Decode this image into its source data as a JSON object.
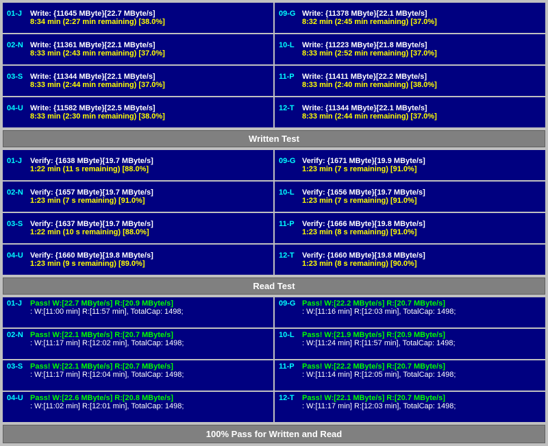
{
  "sections": {
    "write_test": {
      "label": "Written Test",
      "cards": [
        {
          "id": "01-J",
          "side": "left",
          "line1": "Write: {11645 MByte}[22.7 MByte/s]",
          "line2": "8:34 min (2:27 min remaining)  [38.0%]"
        },
        {
          "id": "09-G",
          "side": "right",
          "line1": "Write: {11378 MByte}[22.1 MByte/s]",
          "line2": "8:32 min (2:45 min remaining)  [37.0%]"
        },
        {
          "id": "02-N",
          "side": "left",
          "line1": "Write: {11361 MByte}[22.1 MByte/s]",
          "line2": "8:33 min (2:43 min remaining)  [37.0%]"
        },
        {
          "id": "10-L",
          "side": "right",
          "line1": "Write: {11223 MByte}[21.8 MByte/s]",
          "line2": "8:33 min (2:52 min remaining)  [37.0%]"
        },
        {
          "id": "03-S",
          "side": "left",
          "line1": "Write: {11344 MByte}[22.1 MByte/s]",
          "line2": "8:33 min (2:44 min remaining)  [37.0%]"
        },
        {
          "id": "11-P",
          "side": "right",
          "line1": "Write: {11411 MByte}[22.2 MByte/s]",
          "line2": "8:33 min (2:40 min remaining)  [38.0%]"
        },
        {
          "id": "04-U",
          "side": "left",
          "line1": "Write: {11582 MByte}[22.5 MByte/s]",
          "line2": "8:33 min (2:30 min remaining)  [38.0%]"
        },
        {
          "id": "12-T",
          "side": "right",
          "line1": "Write: {11344 MByte}[22.1 MByte/s]",
          "line2": "8:33 min (2:44 min remaining)  [37.0%]"
        }
      ]
    },
    "verify_test": {
      "label": "Written Test",
      "cards": [
        {
          "id": "01-J",
          "side": "left",
          "line1": "Verify: {1638 MByte}[19.7 MByte/s]",
          "line2": "1:22 min (11 s remaining)  [88.0%]"
        },
        {
          "id": "09-G",
          "side": "right",
          "line1": "Verify: {1671 MByte}[19.9 MByte/s]",
          "line2": "1:23 min (7 s remaining)  [91.0%]"
        },
        {
          "id": "02-N",
          "side": "left",
          "line1": "Verify: {1657 MByte}[19.7 MByte/s]",
          "line2": "1:23 min (7 s remaining)  [91.0%]"
        },
        {
          "id": "10-L",
          "side": "right",
          "line1": "Verify: {1656 MByte}[19.7 MByte/s]",
          "line2": "1:23 min (7 s remaining)  [91.0%]"
        },
        {
          "id": "03-S",
          "side": "left",
          "line1": "Verify: {1637 MByte}[19.7 MByte/s]",
          "line2": "1:22 min (10 s remaining)  [88.0%]"
        },
        {
          "id": "11-P",
          "side": "right",
          "line1": "Verify: {1666 MByte}[19.8 MByte/s]",
          "line2": "1:23 min (8 s remaining)  [91.0%]"
        },
        {
          "id": "04-U",
          "side": "left",
          "line1": "Verify: {1660 MByte}[19.8 MByte/s]",
          "line2": "1:23 min (9 s remaining)  [89.0%]"
        },
        {
          "id": "12-T",
          "side": "right",
          "line1": "Verify: {1660 MByte}[19.8 MByte/s]",
          "line2": "1:23 min (8 s remaining)  [90.0%]"
        }
      ]
    },
    "read_test": {
      "label": "Read Test",
      "cards": [
        {
          "id": "01-J",
          "side": "left",
          "line1": "Pass! W:[22.7 MByte/s] R:[20.9 MByte/s]",
          "line2": ": W:[11:00 min] R:[11:57 min], TotalCap: 1498;"
        },
        {
          "id": "09-G",
          "side": "right",
          "line1": "Pass! W:[22.2 MByte/s] R:[20.7 MByte/s]",
          "line2": ": W:[11:16 min] R:[12:03 min], TotalCap: 1498;"
        },
        {
          "id": "02-N",
          "side": "left",
          "line1": "Pass! W:[22.1 MByte/s] R:[20.7 MByte/s]",
          "line2": ": W:[11:17 min] R:[12:02 min], TotalCap: 1498;"
        },
        {
          "id": "10-L",
          "side": "right",
          "line1": "Pass! W:[21.9 MByte/s] R:[20.9 MByte/s]",
          "line2": ": W:[11:24 min] R:[11:57 min], TotalCap: 1498;"
        },
        {
          "id": "03-S",
          "side": "left",
          "line1": "Pass! W:[22.1 MByte/s] R:[20.7 MByte/s]",
          "line2": ": W:[11:17 min] R:[12:04 min], TotalCap: 1498;"
        },
        {
          "id": "11-P",
          "side": "right",
          "line1": "Pass! W:[22.2 MByte/s] R:[20.7 MByte/s]",
          "line2": ": W:[11:14 min] R:[12:05 min], TotalCap: 1498;"
        },
        {
          "id": "04-U",
          "side": "left",
          "line1": "Pass! W:[22.6 MByte/s] R:[20.8 MByte/s]",
          "line2": ": W:[11:02 min] R:[12:01 min], TotalCap: 1498;"
        },
        {
          "id": "12-T",
          "side": "right",
          "line1": "Pass! W:[22.1 MByte/s] R:[20.7 MByte/s]",
          "line2": ": W:[11:17 min] R:[12:03 min], TotalCap: 1498;"
        }
      ]
    }
  },
  "headers": {
    "written_test": "Written Test",
    "read_test": "Read Test"
  },
  "footer": "100% Pass for Written and Read"
}
